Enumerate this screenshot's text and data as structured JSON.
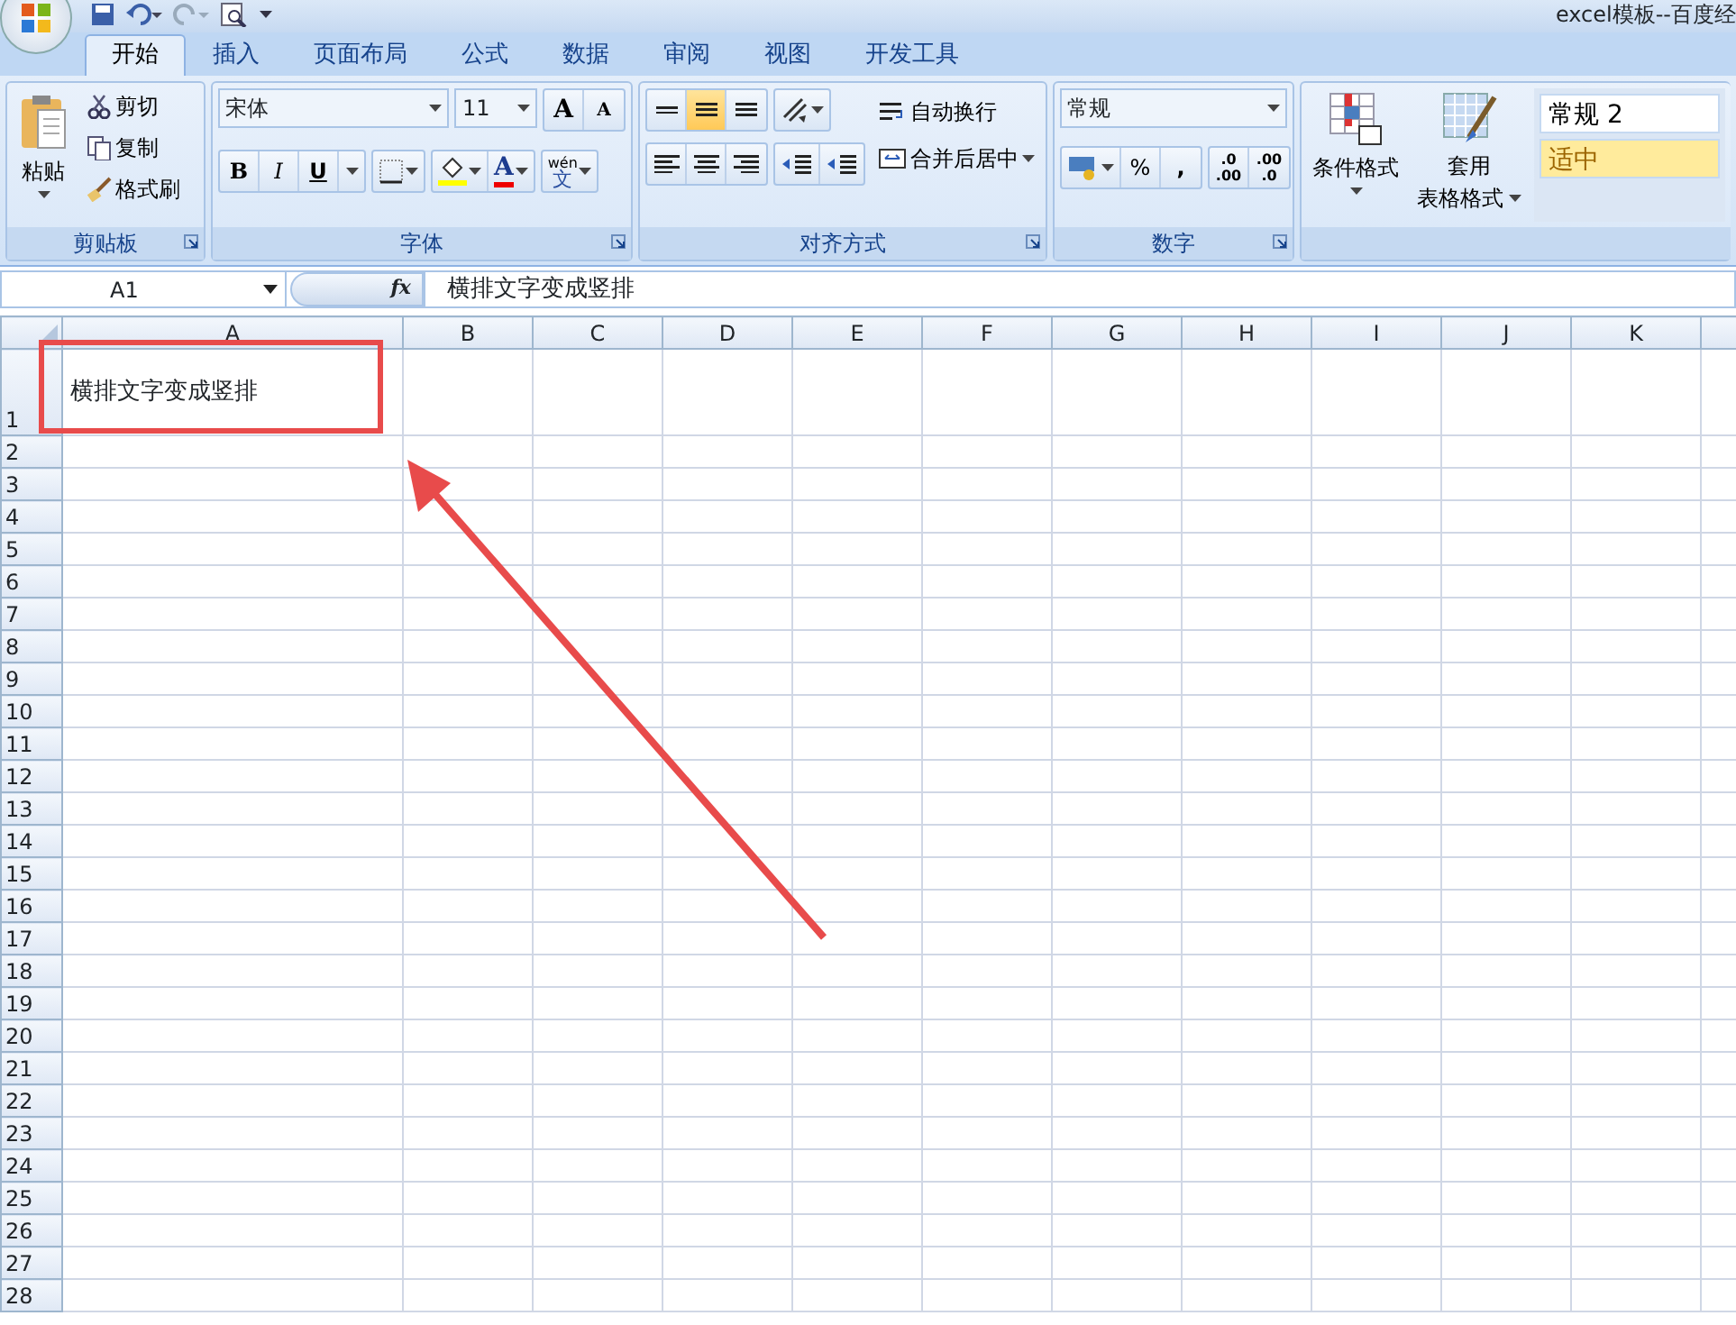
{
  "window": {
    "title": "excel模板--百度经"
  },
  "tabs": [
    {
      "label": "开始",
      "selected": true
    },
    {
      "label": "插入",
      "selected": false
    },
    {
      "label": "页面布局",
      "selected": false
    },
    {
      "label": "公式",
      "selected": false
    },
    {
      "label": "数据",
      "selected": false
    },
    {
      "label": "审阅",
      "selected": false
    },
    {
      "label": "视图",
      "selected": false
    },
    {
      "label": "开发工具",
      "selected": false
    }
  ],
  "ribbon": {
    "clipboard": {
      "paste": "粘贴",
      "cut": "剪切",
      "copy": "复制",
      "format_painter": "格式刷",
      "group_label": "剪贴板"
    },
    "font": {
      "font_name": "宋体",
      "font_size": "11",
      "grow": "A",
      "shrink": "A",
      "bold": "B",
      "italic": "I",
      "underline": "U",
      "font_color": "A",
      "phonetic_top": "wén",
      "phonetic_char": "文",
      "group_label": "字体"
    },
    "alignment": {
      "vertical": [
        {
          "selected": false
        },
        {
          "selected": true
        },
        {
          "selected": false
        }
      ],
      "horizontal": [
        {
          "selected": false
        },
        {
          "selected": false
        },
        {
          "selected": false
        }
      ],
      "wrap_text": "自动换行",
      "merge_center": "合并后居中",
      "group_label": "对齐方式"
    },
    "number": {
      "format": "常规",
      "percent": "%",
      "comma": ",",
      "increase_decimal": [
        ".0",
        ".00"
      ],
      "decrease_decimal": [
        ".00",
        ".0"
      ],
      "group_label": "数字"
    },
    "styles": {
      "conditional_format": "条件格式",
      "format_as_table": [
        "套用",
        "表格格式"
      ],
      "cell_styles": [
        {
          "label": "常规 2",
          "kind": "normal"
        },
        {
          "label": "适中",
          "kind": "neutral"
        }
      ]
    }
  },
  "formula_bar": {
    "name_box": "A1",
    "fx": "fx",
    "content": "横排文字变成竖排"
  },
  "sheet": {
    "columns": [
      "A",
      "B",
      "C",
      "D",
      "E",
      "F",
      "G",
      "H",
      "I",
      "J",
      "K"
    ],
    "rows": [
      {
        "header": "1",
        "cells": [
          "横排文字变成竖排"
        ]
      },
      {
        "header": "2"
      },
      {
        "header": "3"
      },
      {
        "header": "4"
      },
      {
        "header": "5"
      },
      {
        "header": "6"
      },
      {
        "header": "7"
      },
      {
        "header": "8"
      },
      {
        "header": "9"
      },
      {
        "header": "10"
      },
      {
        "header": "11"
      },
      {
        "header": "12"
      },
      {
        "header": "13"
      },
      {
        "header": "14"
      },
      {
        "header": "15"
      },
      {
        "header": "16"
      },
      {
        "header": "17"
      },
      {
        "header": "18"
      },
      {
        "header": "19"
      },
      {
        "header": "20"
      },
      {
        "header": "21"
      },
      {
        "header": "22"
      },
      {
        "header": "23"
      },
      {
        "header": "24"
      },
      {
        "header": "25"
      },
      {
        "header": "26"
      },
      {
        "header": "27"
      },
      {
        "header": "28"
      }
    ]
  }
}
